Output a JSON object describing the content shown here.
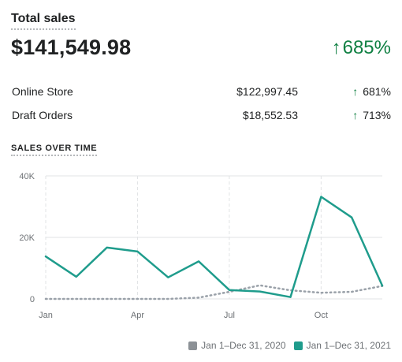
{
  "header": {
    "title": "Total sales",
    "total": "$141,549.98",
    "change_arrow": "↑",
    "change": "685%"
  },
  "breakdown": [
    {
      "label": "Online Store",
      "value": "$122,997.45",
      "arrow": "↑",
      "change": "681%"
    },
    {
      "label": "Draft Orders",
      "value": "$18,552.53",
      "arrow": "↑",
      "change": "713%"
    }
  ],
  "section": {
    "label": "SALES OVER TIME"
  },
  "colors": {
    "positive": "#108043",
    "current": "#1f9c8c",
    "previous": "#9aa1a9",
    "grid": "#e1e3e5"
  },
  "legend": [
    {
      "label": "Jan 1–Dec 31, 2020",
      "color": "#8c9196"
    },
    {
      "label": "Jan 1–Dec 31, 2021",
      "color": "#1f9c8c"
    }
  ],
  "chart_data": {
    "type": "line",
    "x": [
      "Jan",
      "Feb",
      "Mar",
      "Apr",
      "May",
      "Jun",
      "Jul",
      "Aug",
      "Sep",
      "Oct",
      "Nov",
      "Dec"
    ],
    "x_tick_labels": [
      "Jan",
      "Apr",
      "Jul",
      "Oct"
    ],
    "y_tick_labels": [
      "40K",
      "20K",
      "0"
    ],
    "ylim": [
      0,
      40000
    ],
    "grid": true,
    "series": [
      {
        "name": "Jan 1–Dec 31, 2020",
        "style": "dotted",
        "values": [
          0,
          0,
          0,
          0,
          0,
          400,
          2300,
          4400,
          2800,
          2000,
          2300,
          4200
        ]
      },
      {
        "name": "Jan 1–Dec 31, 2021",
        "style": "solid",
        "values": [
          13800,
          7200,
          16700,
          15400,
          7000,
          12200,
          2900,
          2400,
          600,
          33200,
          26500,
          4300
        ]
      }
    ]
  }
}
